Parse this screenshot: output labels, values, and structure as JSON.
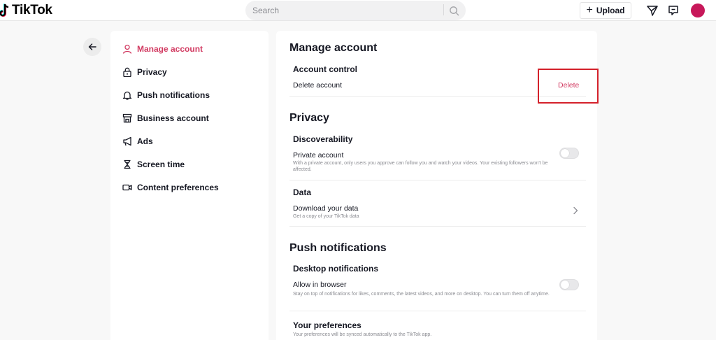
{
  "header": {
    "logo_text": "TikTok",
    "search_placeholder": "Search",
    "upload_label": "Upload",
    "avatar_color": "#c7185a"
  },
  "sidebar": {
    "items": [
      {
        "label": "Manage account",
        "icon": "person-icon",
        "active": true
      },
      {
        "label": "Privacy",
        "icon": "lock-icon"
      },
      {
        "label": "Push notifications",
        "icon": "bell-icon"
      },
      {
        "label": "Business account",
        "icon": "store-icon"
      },
      {
        "label": "Ads",
        "icon": "megaphone-icon"
      },
      {
        "label": "Screen time",
        "icon": "hourglass-icon"
      },
      {
        "label": "Content preferences",
        "icon": "video-icon"
      }
    ]
  },
  "main": {
    "manage_account": {
      "title": "Manage account",
      "account_control": {
        "subtitle": "Account control",
        "delete_label": "Delete account",
        "delete_button": "Delete"
      }
    },
    "privacy": {
      "title": "Privacy",
      "discoverability": {
        "subtitle": "Discoverability",
        "private_label": "Private account",
        "private_desc": "With a private account, only users you approve can follow you and watch your videos. Your existing followers won't be affected.",
        "private_enabled": false
      },
      "data": {
        "subtitle": "Data",
        "download_label": "Download your data",
        "download_desc": "Get a copy of your TikTok data"
      }
    },
    "push": {
      "title": "Push notifications",
      "desktop": {
        "subtitle": "Desktop notifications",
        "allow_label": "Allow in browser",
        "allow_desc": "Stay on top of notifications for likes, comments, the latest videos, and more on desktop. You can turn them off anytime.",
        "allow_enabled": false
      },
      "preferences": {
        "subtitle": "Your preferences",
        "desc": "Your preferences will be synced automatically to the TikTok app."
      }
    }
  },
  "colors": {
    "accent": "#d23b62",
    "highlight_box": "#d4212b"
  }
}
